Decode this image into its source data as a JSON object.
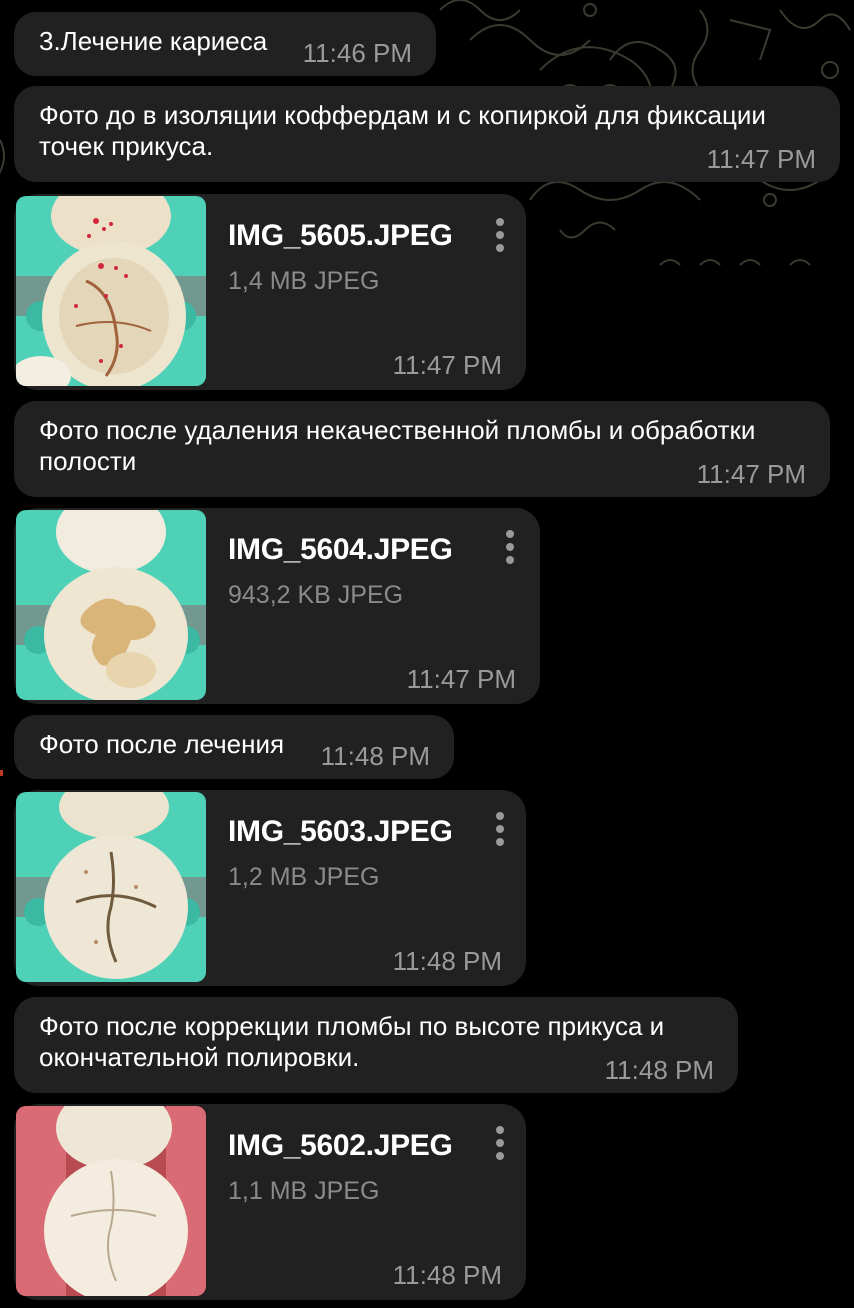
{
  "messages": [
    {
      "type": "text",
      "text": "3.Лечение кариеса",
      "time": "11:46 PM"
    },
    {
      "type": "text",
      "text": "Фото до в изоляции коффердам и с копиркой для фиксации точек прикуса.",
      "time": "11:47 PM"
    },
    {
      "type": "file",
      "name": "IMG_5605.JPEG",
      "size": "1,4 MB JPEG",
      "time": "11:47 PM"
    },
    {
      "type": "text",
      "text": "Фото после удаления некачественной пломбы и обработки полости",
      "time": "11:47 PM"
    },
    {
      "type": "file",
      "name": "IMG_5604.JPEG",
      "size": "943,2 KB JPEG",
      "time": "11:47 PM"
    },
    {
      "type": "text",
      "text": "Фото после лечения",
      "time": "11:48 PM"
    },
    {
      "type": "file",
      "name": "IMG_5603.JPEG",
      "size": "1,2 MB JPEG",
      "time": "11:48 PM"
    },
    {
      "type": "text",
      "text": "Фото после коррекции пломбы по высоте прикуса и окончательной полировки.",
      "time": "11:48 PM"
    },
    {
      "type": "file",
      "name": "IMG_5602.JPEG",
      "size": "1,1 MB JPEG",
      "time": "11:48 PM"
    }
  ],
  "icons": {
    "file_menu": "more-vertical-icon"
  },
  "colors": {
    "background": "#000000",
    "bubble": "#212121",
    "text": "#ffffff",
    "meta_text": "#9a9a9a",
    "dam_green": "#4fd1b8"
  }
}
